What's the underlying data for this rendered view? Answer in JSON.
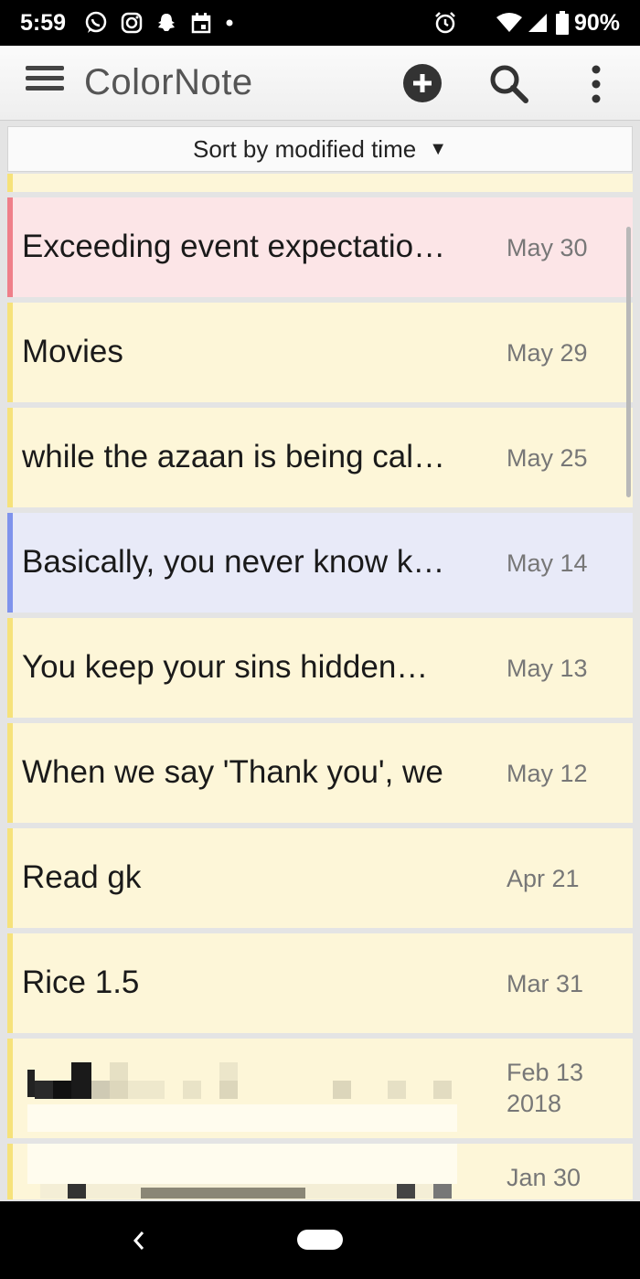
{
  "status_bar": {
    "time": "5:59",
    "icons_left": [
      "whatsapp-icon",
      "instagram-icon",
      "snapchat-icon",
      "calendar-icon",
      "dot-icon"
    ],
    "icons_right": [
      "alarm-icon",
      "wifi-icon",
      "signal-icon",
      "battery-icon"
    ],
    "battery": "90%"
  },
  "app_bar": {
    "title": "ColorNote",
    "actions": [
      "add-note",
      "search",
      "more-options"
    ]
  },
  "sort": {
    "label": "Sort by modified time"
  },
  "notes": [
    {
      "title": "Exceeding event expectatio…",
      "date": "May 30",
      "color": "#ef7f89"
    },
    {
      "title": "Movies",
      "date": "May 29",
      "color": "#f6e27a"
    },
    {
      "title": "while the azaan is being cal…",
      "date": "May 25",
      "color": "#f6e27a"
    },
    {
      "title": "Basically, you never know k…",
      "date": "May 14",
      "color": "#7f93ec"
    },
    {
      "title": "You keep your sins hidden…",
      "date": "May 13",
      "color": "#f6e27a"
    },
    {
      "title": "When we say 'Thank you', we",
      "date": "May 12",
      "color": "#f6e27a"
    },
    {
      "title": "Read gk",
      "date": "Apr 21",
      "color": "#f6e27a"
    },
    {
      "title": "Rice 1.5",
      "date": "Mar 31",
      "color": "#f6e27a"
    },
    {
      "title": "",
      "date": "Feb 13 2018",
      "color": "#f6e27a"
    },
    {
      "title": "",
      "date": "Jan 30",
      "color": "#f6e27a"
    }
  ],
  "colors": {
    "yellow_bg": "#fdf6d8",
    "pink_bg": "#fce5e7",
    "blue_bg": "#e8eaf8"
  }
}
